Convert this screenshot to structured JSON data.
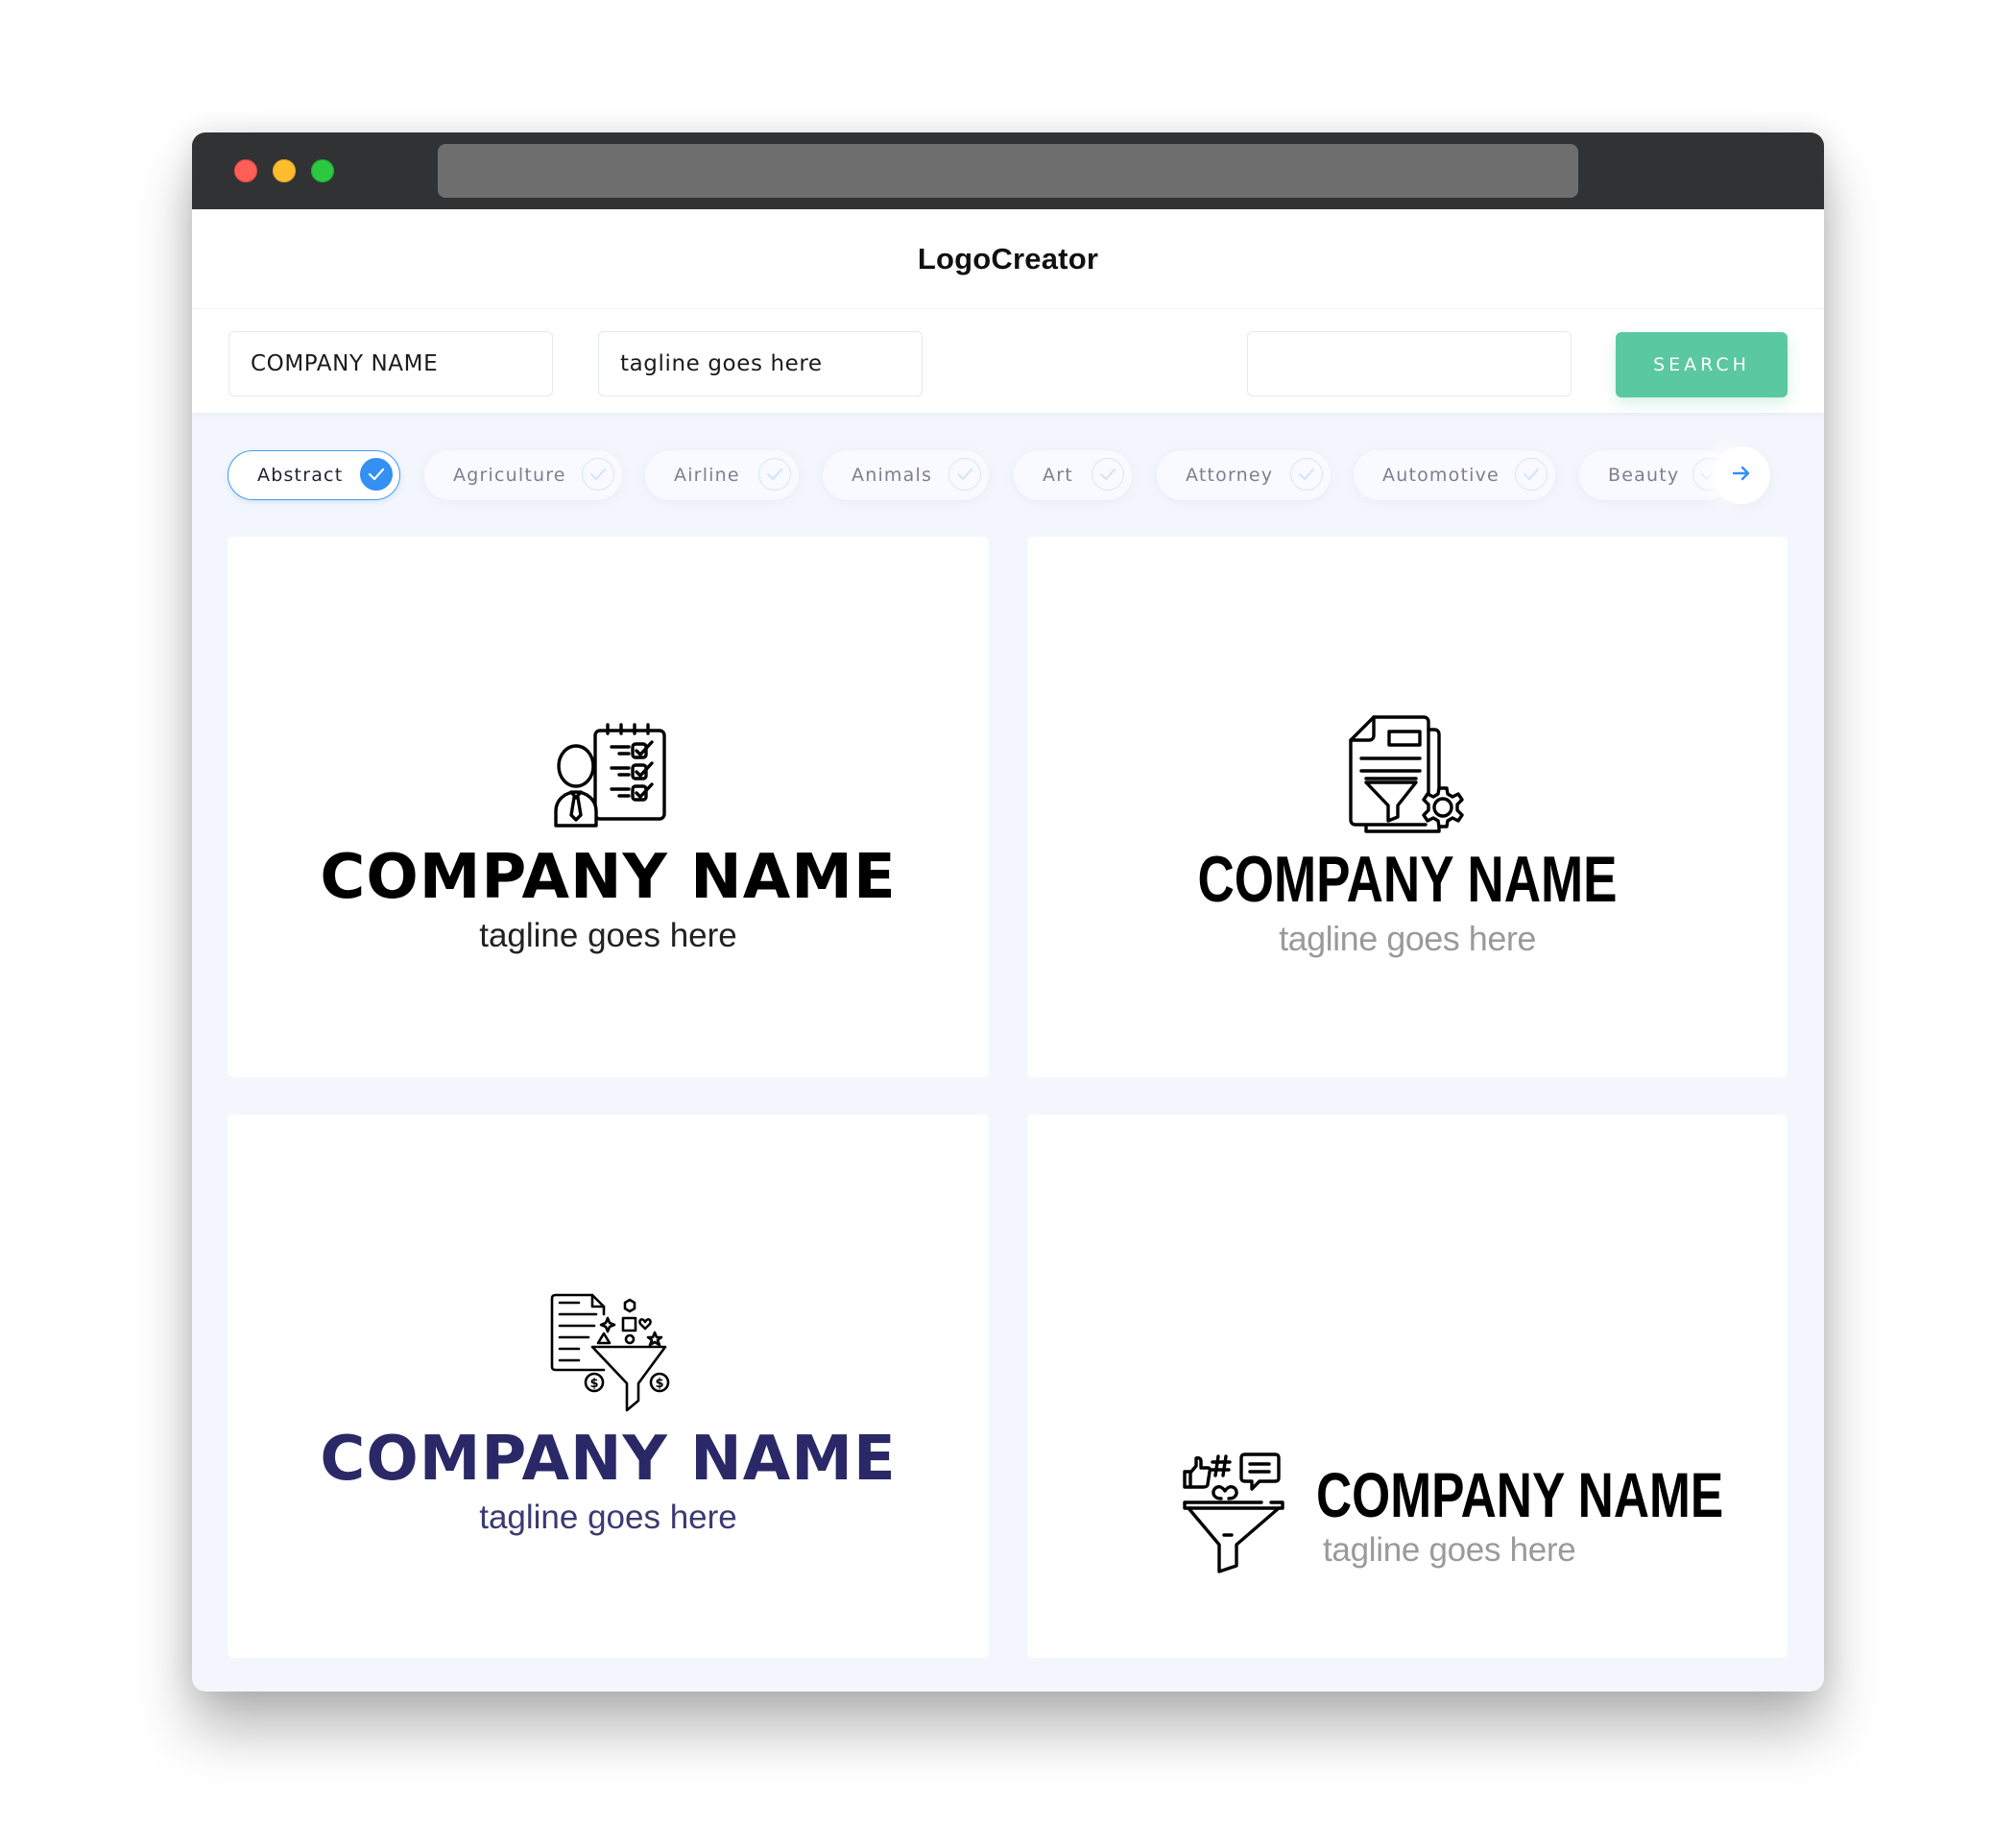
{
  "browser": {
    "window_controls": [
      "close",
      "minimize",
      "maximize"
    ],
    "url": ""
  },
  "header": {
    "title": "LogoCreator"
  },
  "search": {
    "company_name_value": "COMPANY NAME",
    "tagline_value": "tagline goes here",
    "keyword_value": "",
    "button_label": "SEARCH",
    "button_color": "#5ac8a0"
  },
  "categories": {
    "items": [
      {
        "label": "Abstract",
        "selected": true
      },
      {
        "label": "Agriculture",
        "selected": false
      },
      {
        "label": "Airline",
        "selected": false
      },
      {
        "label": "Animals",
        "selected": false
      },
      {
        "label": "Art",
        "selected": false
      },
      {
        "label": "Attorney",
        "selected": false
      },
      {
        "label": "Automotive",
        "selected": false
      },
      {
        "label": "Beauty",
        "selected": false
      }
    ],
    "next_icon": "arrow-right-icon",
    "selected_color": "#3490f3"
  },
  "logos": [
    {
      "icon": "person-checklist-icon",
      "company_name": "COMPANY NAME",
      "tagline": "tagline goes here",
      "name_color": "#000000",
      "tagline_color": "#222222"
    },
    {
      "icon": "document-funnel-gear-icon",
      "company_name": "COMPANY NAME",
      "tagline": "tagline goes here",
      "name_color": "#000000",
      "tagline_color": "#9a9a9a"
    },
    {
      "icon": "document-shapes-funnel-dollar-icon",
      "company_name": "COMPANY NAME",
      "tagline": "tagline goes here",
      "name_color": "#2a2866",
      "tagline_color": "#3b3a72"
    },
    {
      "icon": "social-media-funnel-icon",
      "company_name": "COMPANY NAME",
      "tagline": "tagline goes here",
      "name_color": "#000000",
      "tagline_color": "#9a9a9a"
    }
  ]
}
